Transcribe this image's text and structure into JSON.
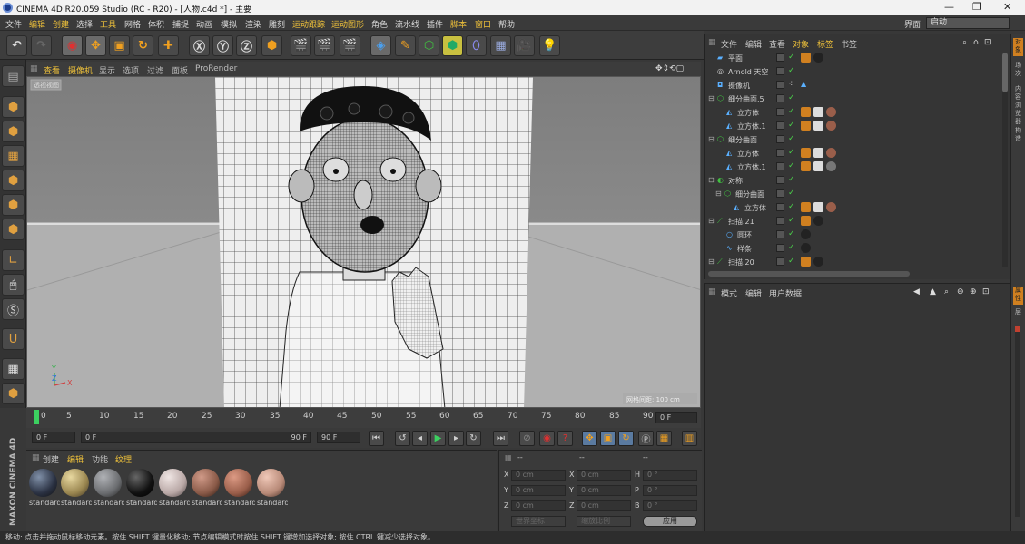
{
  "window": {
    "title": "CINEMA 4D R20.059 Studio (RC - R20) - [人物.c4d *] - 主要",
    "minimize": "—",
    "maximize": "❐",
    "close": "✕"
  },
  "menubar": {
    "items": [
      "文件",
      "编辑",
      "创建",
      "选择",
      "工具",
      "网格",
      "体积",
      "捕捉",
      "动画",
      "模拟",
      "渲染",
      "雕刻",
      "运动跟踪",
      "运动图形",
      "角色",
      "流水线",
      "插件",
      "脚本",
      "窗口",
      "帮助"
    ],
    "layout_label": "界面:",
    "layout_value": "启动"
  },
  "viewport": {
    "menu": [
      "查看",
      "摄像机",
      "显示",
      "选项",
      "过滤",
      "面板",
      "ProRender"
    ],
    "camera_tag": "透视视图",
    "axis_y": "Y",
    "axis_z": "Z",
    "axis_x": "X",
    "grid_spacing": "网格间距: 100 cm"
  },
  "timeline": {
    "ticks": [
      "0",
      "5",
      "10",
      "15",
      "20",
      "25",
      "30",
      "35",
      "40",
      "45",
      "50",
      "55",
      "60",
      "65",
      "70",
      "75",
      "80",
      "85",
      "90"
    ],
    "current_frame": "0 F",
    "start": "0 F",
    "range_start": "0 F",
    "range_end": "90 F",
    "end": "90 F"
  },
  "materials": {
    "menu": [
      "创建",
      "编辑",
      "功能",
      "纹理"
    ],
    "items": [
      {
        "label": "standard",
        "color": "#2a3142"
      },
      {
        "label": "standard",
        "color": "#9a8650"
      },
      {
        "label": "standard",
        "color": "#6b6d70"
      },
      {
        "label": "standard",
        "color": "#101010"
      },
      {
        "label": "standard",
        "color": "#b9a8a6"
      },
      {
        "label": "standard",
        "color": "#8a5a48"
      },
      {
        "label": "standard",
        "color": "#9a5e4a"
      },
      {
        "label": "standard",
        "color": "#b88a78"
      }
    ]
  },
  "coords": {
    "header1": "--",
    "header2": "--",
    "header3": "--",
    "rows": [
      {
        "a": "X",
        "av": "0 cm",
        "b": "X",
        "bv": "0 cm",
        "c": "H",
        "cv": "0 °"
      },
      {
        "a": "Y",
        "av": "0 cm",
        "b": "Y",
        "bv": "0 cm",
        "c": "P",
        "cv": "0 °"
      },
      {
        "a": "Z",
        "av": "0 cm",
        "b": "Z",
        "bv": "0 cm",
        "c": "B",
        "cv": "0 °"
      }
    ],
    "mode1": "世界坐标",
    "mode2": "缩放比例",
    "apply": "应用"
  },
  "objects": {
    "menu": [
      "文件",
      "编辑",
      "查看",
      "对象",
      "标签",
      "书签"
    ],
    "rows": [
      {
        "name": "平面",
        "indent": 0
      },
      {
        "name": "Arnold 天空",
        "indent": 0
      },
      {
        "name": "摄像机",
        "indent": 0
      },
      {
        "name": "细分曲面.5",
        "indent": 0
      },
      {
        "name": "立方体",
        "indent": 1
      },
      {
        "name": "立方体.1",
        "indent": 1
      },
      {
        "name": "细分曲面",
        "indent": 0
      },
      {
        "name": "立方体",
        "indent": 1
      },
      {
        "name": "立方体.1",
        "indent": 1
      },
      {
        "name": "对称",
        "indent": 0
      },
      {
        "name": "细分曲面",
        "indent": 1
      },
      {
        "name": "立方体",
        "indent": 2
      },
      {
        "name": "扫描.21",
        "indent": 0
      },
      {
        "name": "圆环",
        "indent": 1
      },
      {
        "name": "样条",
        "indent": 1
      },
      {
        "name": "扫描.20",
        "indent": 0
      }
    ]
  },
  "attributes": {
    "menu": [
      "模式",
      "编辑",
      "用户数据"
    ]
  },
  "rightstrip": [
    "对象",
    "场次",
    "内容浏览器",
    "构造"
  ],
  "rightstrip2": [
    "属性",
    "层"
  ],
  "status": "移动: 点击并拖动鼠标移动元素。按住 SHIFT 键量化移动; 节点编辑模式时按住 SHIFT 键增加选择对象; 按住 CTRL 键减少选择对象。",
  "brand": "MAXON CINEMA 4D"
}
